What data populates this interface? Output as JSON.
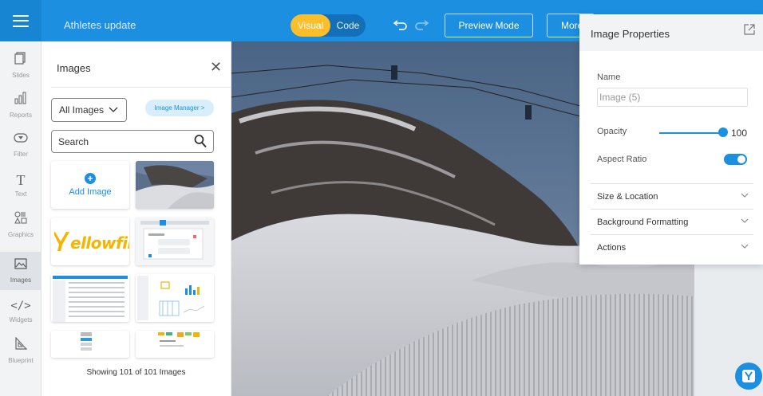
{
  "header": {
    "title": "Athletes update",
    "mode_visual": "Visual",
    "mode_code": "Code",
    "undo_icon": "undo-icon",
    "redo_icon": "redo-icon",
    "preview_label": "Preview Mode",
    "more_label": "More",
    "colors": {
      "bar": "#1c8fe0",
      "toggle_active": "#fcbf2b"
    }
  },
  "rail": {
    "items": [
      {
        "label": "Slides",
        "icon": "slides-icon"
      },
      {
        "label": "Reports",
        "icon": "reports-icon"
      },
      {
        "label": "Filter",
        "icon": "filter-icon"
      },
      {
        "label": "Text",
        "icon": "text-icon"
      },
      {
        "label": "Graphics",
        "icon": "graphics-icon"
      },
      {
        "label": "Images",
        "icon": "images-icon",
        "active": true
      },
      {
        "label": "Widgets",
        "icon": "widgets-icon"
      },
      {
        "label": "Blueprint",
        "icon": "blueprint-icon"
      }
    ]
  },
  "images_panel": {
    "title": "Images",
    "filter_value": "All Images",
    "manager_label": "Image Manager >",
    "search_placeholder": "Search",
    "add_label": "Add Image",
    "logo_text": "ellowfin",
    "footer": "Showing 101 of 101 Images"
  },
  "properties": {
    "title": "Image Properties",
    "name_label": "Name",
    "name_placeholder": "Image (5)",
    "opacity_label": "Opacity",
    "opacity_value": "100",
    "aspect_label": "Aspect Ratio",
    "aspect_on": true,
    "sections": [
      "Size & Location",
      "Background Formatting",
      "Actions"
    ]
  }
}
